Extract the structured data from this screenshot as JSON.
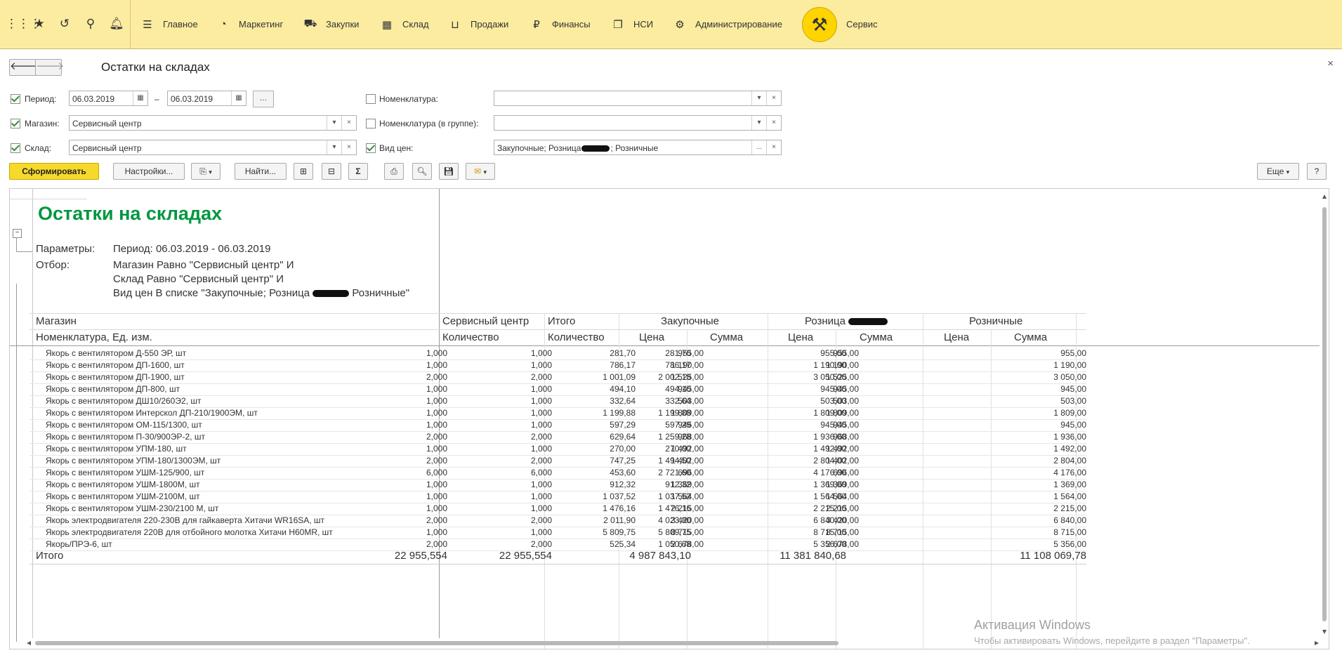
{
  "topbar": {
    "sections": [
      {
        "label": "Главное",
        "icon": "menu-lines-icon"
      },
      {
        "label": "Маркетинг",
        "icon": "pie-chart-icon"
      },
      {
        "label": "Закупки",
        "icon": "cart-icon"
      },
      {
        "label": "Склад",
        "icon": "grid-icon"
      },
      {
        "label": "Продажи",
        "icon": "basket-icon"
      },
      {
        "label": "Финансы",
        "icon": "ruble-icon"
      },
      {
        "label": "НСИ",
        "icon": "documents-icon"
      },
      {
        "label": "Администрирование",
        "icon": "gear-icon"
      },
      {
        "label": "Сервис",
        "icon": "tools-icon"
      }
    ]
  },
  "form": {
    "title": "Остатки на складах"
  },
  "filters": {
    "period": {
      "label": "Период:",
      "from": "06.03.2019",
      "to": "06.03.2019",
      "dash": "–",
      "dots": "..."
    },
    "shop": {
      "label": "Магазин:",
      "value": "Сервисный центр"
    },
    "warehouse": {
      "label": "Склад:",
      "value": "Сервисный центр"
    },
    "nomenclature": {
      "label": "Номенклатура:",
      "value": ""
    },
    "nomenclature_group": {
      "label": "Номенклатура (в группе):",
      "value": ""
    },
    "price_type": {
      "label": "Вид цен:",
      "value": "Закупочные; Розница",
      "value_tail": "; Розничные",
      "dots": "..."
    }
  },
  "toolbar": {
    "generate": "Сформировать",
    "settings": "Настройки...",
    "find": "Найти...",
    "more": "Еще",
    "help": "?"
  },
  "report": {
    "title": "Остатки на складах",
    "params_label": "Параметры:",
    "params_value": "Период: 06.03.2019 - 06.03.2019",
    "filter_label": "Отбор:",
    "filter_lines": [
      "Магазин Равно \"Сервисный центр\" И",
      "Склад Равно \"Сервисный центр\" И",
      "Вид цен В списке \"Закупочные; Розница",
      "Розничные\""
    ],
    "headers": {
      "row1": [
        "Магазин",
        "Сервисный центр",
        "Итого",
        "Закупочные",
        "Розница",
        "Розничные"
      ],
      "row2": [
        "Номенклатура, Ед. изм.",
        "Количество",
        "Количество",
        "Цена",
        "Сумма",
        "Цена",
        "Сумма",
        "Цена",
        "Сумма"
      ]
    },
    "rows": [
      [
        "Якорь с вентилятором Д-550 ЭР, шт",
        "1,000",
        "1,000",
        "281,70",
        "281,70",
        "955,00",
        "955,00",
        "955,00",
        "955,00"
      ],
      [
        "Якорь с вентилятором ДП-1600, шт",
        "1,000",
        "1,000",
        "786,17",
        "786,17",
        "1 190,00",
        "1 190,00",
        "1 190,00",
        "1 190,00"
      ],
      [
        "Якорь с вентилятором ДП-1900, шт",
        "2,000",
        "2,000",
        "1 001,09",
        "2 002,18",
        "1 525,00",
        "3 050,00",
        "1 525,00",
        "3 050,00"
      ],
      [
        "Якорь с вентилятором ДП-800, шт",
        "1,000",
        "1,000",
        "494,10",
        "494,10",
        "945,00",
        "945,00",
        "945,00",
        "945,00"
      ],
      [
        "Якорь с вентилятором ДШ10/260Э2, шт",
        "1,000",
        "1,000",
        "332,64",
        "332,64",
        "503,00",
        "503,00",
        "503,00",
        "503,00"
      ],
      [
        "Якорь с вентилятором Интерскол  ДП-210/1900ЭМ, шт",
        "1,000",
        "1,000",
        "1 199,88",
        "1 199,88",
        "1 809,00",
        "1 809,00",
        "1 809,00",
        "1 809,00"
      ],
      [
        "Якорь с вентилятором ОМ-115/1300, шт",
        "1,000",
        "1,000",
        "597,29",
        "597,29",
        "945,00",
        "945,00",
        "945,00",
        "945,00"
      ],
      [
        "Якорь с вентилятором П-30/900ЭР-2, шт",
        "2,000",
        "2,000",
        "629,64",
        "1 259,28",
        "968,00",
        "1 936,00",
        "968,00",
        "1 936,00"
      ],
      [
        "Якорь с вентилятором УПМ-180, шт",
        "1,000",
        "1,000",
        "270,00",
        "270,00",
        "1 492,00",
        "1 492,00",
        "1 492,00",
        "1 492,00"
      ],
      [
        "Якорь с вентилятором УПМ-180/1300ЭМ, шт",
        "2,000",
        "2,000",
        "747,25",
        "1 494,50",
        "1 402,00",
        "2 804,00",
        "1 402,00",
        "2 804,00"
      ],
      [
        "Якорь с вентилятором УШМ-125/900, шт",
        "6,000",
        "6,000",
        "453,60",
        "2 721,60",
        "696,00",
        "4 176,00",
        "696,00",
        "4 176,00"
      ],
      [
        "Якорь с вентилятором УШМ-1800М, шт",
        "1,000",
        "1,000",
        "912,32",
        "912,32",
        "1 369,00",
        "1 369,00",
        "1 369,00",
        "1 369,00"
      ],
      [
        "Якорь с вентилятором УШМ-2100М, шт",
        "1,000",
        "1,000",
        "1 037,52",
        "1 037,52",
        "1 564,00",
        "1 564,00",
        "1 564,00",
        "1 564,00"
      ],
      [
        "Якорь с вентилятором УШМ-230/2100 М, шт",
        "1,000",
        "1,000",
        "1 476,16",
        "1 476,16",
        "2 215,00",
        "2 215,00",
        "2 215,00",
        "2 215,00"
      ],
      [
        "Якорь электродвигателя 220-230В для гайкаверта Хитачи WR16SA, шт",
        "2,000",
        "2,000",
        "2 011,90",
        "4 023,80",
        "3 420,00",
        "6 840,00",
        "3 420,00",
        "6 840,00"
      ],
      [
        "Якорь электродвигателя 220В для отбойного молотка Хитачи  H60MR, шт",
        "1,000",
        "1,000",
        "5 809,75",
        "5 809,75",
        "8 715,00",
        "8 715,00",
        "8 715,00",
        "8 715,00"
      ],
      [
        "Якорь/ПРЭ-6, шт",
        "2,000",
        "2,000",
        "525,34",
        "1 050,68",
        "2 678,00",
        "5 356,00",
        "2 678,00",
        "5 356,00"
      ]
    ],
    "total": [
      "Итого",
      "22 955,554",
      "22 955,554",
      "",
      "4 987 843,10",
      "",
      "11 381 840,68",
      "",
      "11 108 069,78"
    ]
  },
  "watermark": {
    "line1": "Активация Windows",
    "line2": "Чтобы активировать Windows, перейдите в раздел \"Параметры\"."
  }
}
